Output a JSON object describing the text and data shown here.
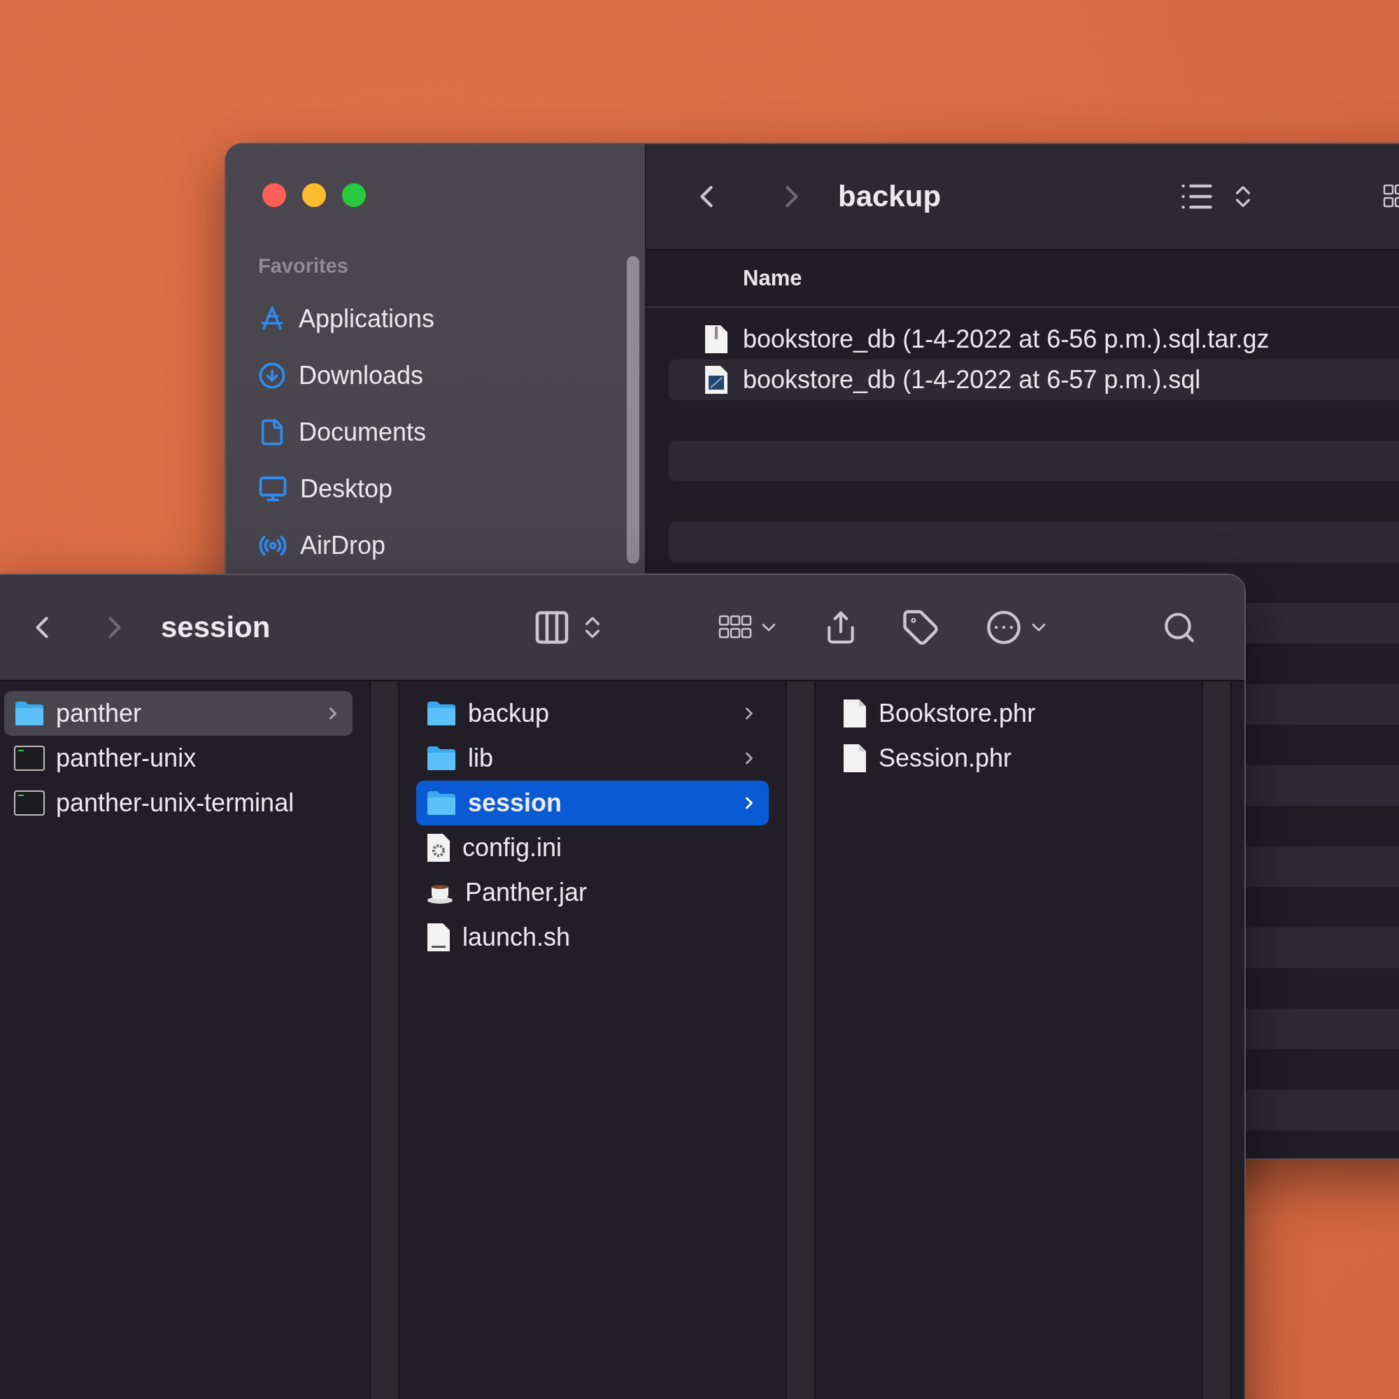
{
  "back_window": {
    "title": "backup",
    "sidebar": {
      "section": "Favorites",
      "items": [
        {
          "label": "Applications"
        },
        {
          "label": "Downloads"
        },
        {
          "label": "Documents"
        },
        {
          "label": "Desktop"
        },
        {
          "label": "AirDrop"
        }
      ]
    },
    "column_header": "Name",
    "files": [
      {
        "name": "bookstore_db (1-4-2022 at 6-56 p.m.).sql.tar.gz",
        "kind": "archive"
      },
      {
        "name": "bookstore_db (1-4-2022 at 6-57 p.m.).sql",
        "kind": "sql"
      }
    ]
  },
  "front_window": {
    "title": "session",
    "columns": [
      {
        "focused": false,
        "items": [
          {
            "name": "panther",
            "kind": "folder",
            "selected": true
          },
          {
            "name": "panther-unix",
            "kind": "terminal",
            "selected": false
          },
          {
            "name": "panther-unix-terminal",
            "kind": "terminal",
            "selected": false
          }
        ]
      },
      {
        "focused": true,
        "items": [
          {
            "name": "backup",
            "kind": "folder",
            "selected": false
          },
          {
            "name": "lib",
            "kind": "folder",
            "selected": false
          },
          {
            "name": "session",
            "kind": "folder",
            "selected": true
          },
          {
            "name": "config.ini",
            "kind": "config",
            "selected": false
          },
          {
            "name": "Panther.jar",
            "kind": "jar",
            "selected": false
          },
          {
            "name": "launch.sh",
            "kind": "shell",
            "selected": false
          }
        ]
      },
      {
        "items": [
          {
            "name": "Bookstore.phr",
            "kind": "document",
            "selected": false
          },
          {
            "name": "Session.phr",
            "kind": "document",
            "selected": false
          }
        ]
      }
    ]
  }
}
